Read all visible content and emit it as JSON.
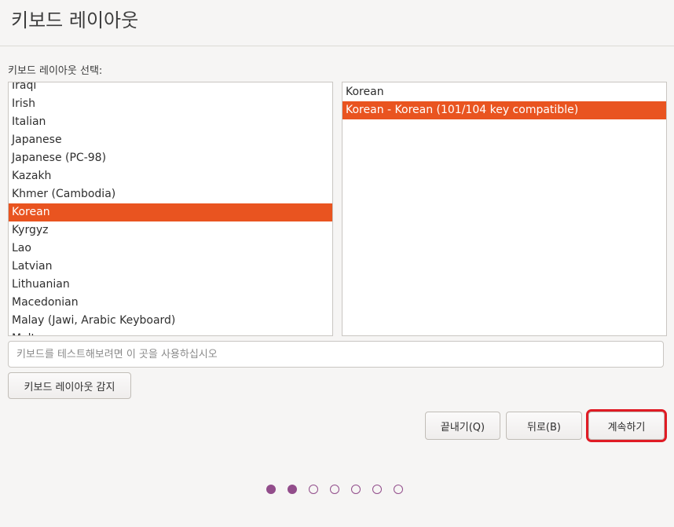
{
  "header": {
    "title": "키보드 레이아웃"
  },
  "selection": {
    "label": "키보드 레이아웃 선택:"
  },
  "layouts": [
    "Iraqi",
    "Irish",
    "Italian",
    "Japanese",
    "Japanese (PC-98)",
    "Kazakh",
    "Khmer (Cambodia)",
    "Korean",
    "Kyrgyz",
    "Lao",
    "Latvian",
    "Lithuanian",
    "Macedonian",
    "Malay (Jawi, Arabic Keyboard)",
    "Malt"
  ],
  "selected_layout": "Korean",
  "variants": [
    "Korean",
    "Korean - Korean (101/104 key compatible)"
  ],
  "selected_variant": "Korean - Korean (101/104 key compatible)",
  "test_input": {
    "placeholder": "키보드를 테스트해보려면 이 곳을 사용하십시오",
    "value": ""
  },
  "buttons": {
    "detect": "키보드 레이아웃 감지",
    "quit": "끝내기(Q)",
    "back": "뒤로(B)",
    "continue": "계속하기"
  },
  "progress": {
    "total_steps": 7,
    "current_step": 2
  },
  "colors": {
    "accent": "#e95420",
    "progress": "#924d8b",
    "highlight": "#e01b24"
  }
}
